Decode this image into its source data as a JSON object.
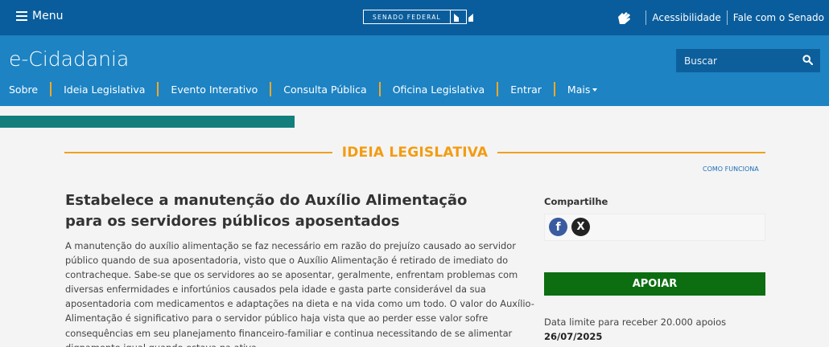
{
  "topbar": {
    "menu_label": "Menu",
    "logo_text": "SENADO FEDERAL",
    "links": [
      "Acessibilidade",
      "Fale com o Senado"
    ]
  },
  "header": {
    "brand": "e-Cidadania",
    "search_placeholder": "Buscar",
    "nav": [
      "Sobre",
      "Ideia Legislativa",
      "Evento Interativo",
      "Consulta Pública",
      "Oficina Legislativa",
      "Entrar",
      "Mais"
    ]
  },
  "section": {
    "title": "IDEIA LEGISLATIVA",
    "how_it_works": "COMO FUNCIONA"
  },
  "idea": {
    "title": "Estabelece a manutenção do Auxílio Alimentação para os servidores públicos aposentados",
    "description": "A manutenção do auxílio alimentação se faz necessário em razão do prejuízo causado ao servidor público quando de sua aposentadoria, visto que o Auxílio Alimentação é retirado de imediato do contracheque. Sabe-se que os servidores ao se aposentar, geralmente, enfrentam problemas com diversas enfermidades e infortúnios causados pela idade e gasta parte considerável da sua aposentadoria com medicamentos e adaptações na dieta e na vida como um todo. O valor do Auxílio-Alimentação é significativo para o servidor público haja vista que ao perder esse valor sofre consequências em seu planejamento financeiro-familiar e continua necessitando de se alimentar dignamente igual quando estava na ativa."
  },
  "sidebar": {
    "share_label": "Compartilhe",
    "facebook_glyph": "f",
    "x_glyph": "X",
    "support_button": "APOIAR",
    "limit_text": "Data limite para receber 20.000 apoios",
    "limit_date": "26/07/2025"
  },
  "colors": {
    "topbar": "#0a5d9c",
    "header": "#1d83c3",
    "accent_orange": "#f39c12",
    "teal_strip": "#127f7c",
    "support_green": "#0c6e11"
  }
}
